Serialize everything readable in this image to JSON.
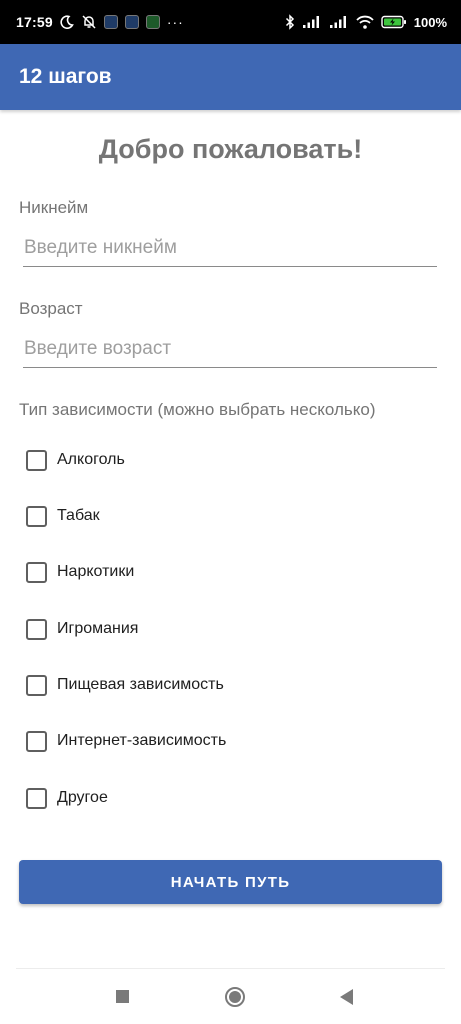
{
  "status_bar": {
    "time": "17:59",
    "dots": "···",
    "battery_percent": "100%"
  },
  "app_bar": {
    "title": "12 шагов"
  },
  "form": {
    "welcome": "Добро пожаловать!",
    "nickname": {
      "label": "Никнейм",
      "placeholder": "Введите никнейм",
      "value": ""
    },
    "age": {
      "label": "Возраст",
      "placeholder": "Введите возраст",
      "value": ""
    },
    "addiction_type": {
      "label": "Тип зависимости (можно выбрать несколько)",
      "options": [
        {
          "label": "Алкоголь",
          "checked": false
        },
        {
          "label": "Табак",
          "checked": false
        },
        {
          "label": "Наркотики",
          "checked": false
        },
        {
          "label": "Игромания",
          "checked": false
        },
        {
          "label": "Пищевая зависимость",
          "checked": false
        },
        {
          "label": "Интернет-зависимость",
          "checked": false
        },
        {
          "label": "Другое",
          "checked": false
        }
      ]
    },
    "start_button": "НАЧАТЬ ПУТЬ"
  },
  "colors": {
    "primary": "#3f68b4",
    "muted_text": "#757575"
  },
  "icons": {
    "status_left": [
      "moon-icon",
      "muted-bell-icon",
      "app-notification-icon",
      "app-notification-icon",
      "app-notification-icon"
    ],
    "status_right": [
      "bluetooth-icon",
      "signal-icon",
      "signal-icon",
      "wifi-icon",
      "battery-charging-icon"
    ],
    "nav": [
      "recents-square-icon",
      "home-circle-icon",
      "back-triangle-icon"
    ]
  }
}
